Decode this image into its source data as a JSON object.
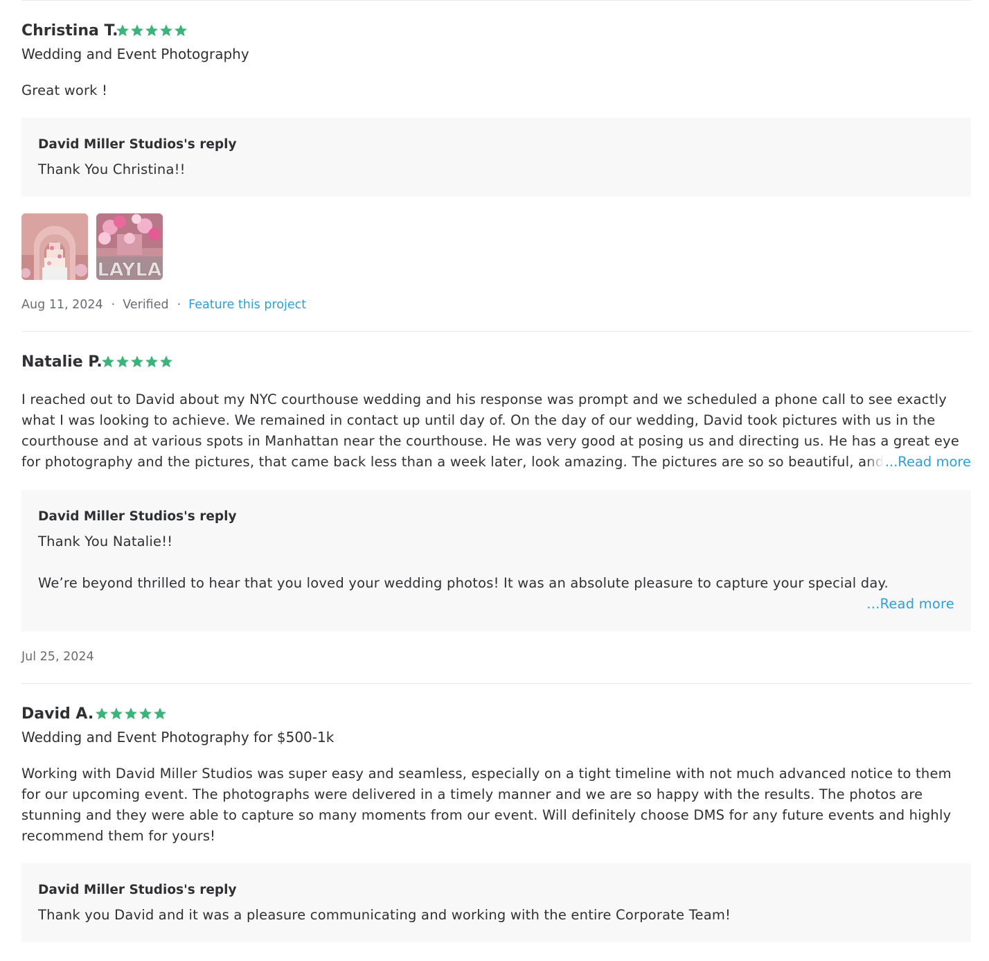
{
  "colors": {
    "star": "#3cb37a",
    "link": "#2d9fd9",
    "text": "#2f3033",
    "muted": "#676d73",
    "reply_bg": "#f8f8f8",
    "divider": "#e9e9eb"
  },
  "reviews": [
    {
      "name": "Christina T.",
      "rating": 5,
      "service": "Wedding and Event Photography",
      "text": "Great work !",
      "reply": {
        "title": "David Miller Studios's reply",
        "text": "Thank You Christina!!"
      },
      "photos": [
        {
          "icon": "pink-arches-cake-photo"
        },
        {
          "icon": "layla-party-decor-photo"
        }
      ],
      "date": "Aug 11, 2024",
      "verified": "Verified",
      "feature_link": "Feature this project"
    },
    {
      "name": "Natalie P.",
      "rating": 5,
      "text": "I reached out to David about my NYC courthouse wedding and his response was prompt and we scheduled a phone call to see exactly what I was looking to achieve. We remained in contact up until day of. On the day of our wedding, David took pictures with us in the courthouse and at various spots in Manhattan near the courthouse. He was very good at posing us and directing us. He has a great eye for photography and the pictures, that came back less than a week later, look amazing. The pictures are so so beautiful, and",
      "read_more": "...Read more",
      "reply": {
        "title": "David Miller Studios's reply",
        "line1": "Thank You Natalie!!",
        "line2": "We’re beyond thrilled to hear that you loved your wedding photos! It was an absolute pleasure to capture your special day.",
        "read_more": "...Read more"
      },
      "date": "Jul 25, 2024"
    },
    {
      "name": "David A.",
      "rating": 5,
      "service": "Wedding and Event Photography for $500-1k",
      "text": "Working with David Miller Studios was super easy and seamless, especially on a tight timeline with not much advanced notice to them for our upcoming event. The photographs were delivered in a timely manner and we are so happy with the results. The photos are stunning and they were able to capture so many moments from our event. Will definitely choose DMS for any future events and highly recommend them for yours!",
      "reply": {
        "title": "David Miller Studios's reply",
        "text": "Thank you David and it was a pleasure communicating and working with the entire Corporate Team!"
      }
    }
  ]
}
